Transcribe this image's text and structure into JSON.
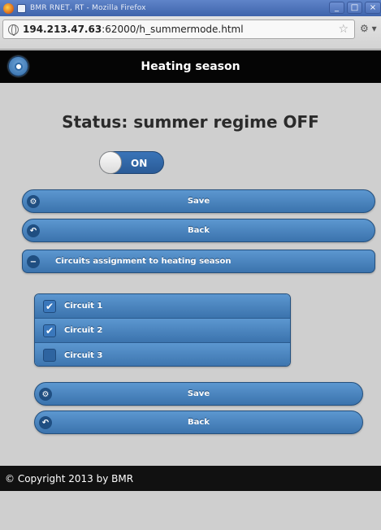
{
  "window": {
    "title": "BMR RNET, RT - Mozilla Firefox",
    "minimize": "_",
    "maximize": "□",
    "close": "×"
  },
  "browser": {
    "url_host": "194.213.47.63",
    "url_rest": ":62000/h_summermode.html",
    "bookmark_star": "☆",
    "tools_glyph": "⚙ ▾"
  },
  "header": {
    "title": "Heating season"
  },
  "status": {
    "text": "Status: summer regime OFF"
  },
  "flip_switch": {
    "label": "ON"
  },
  "top_buttons": {
    "save": "Save",
    "back": "Back"
  },
  "collapsible": {
    "title": "Circuits assignment to heating season",
    "icon_glyph": "−"
  },
  "circuits": [
    {
      "label": "Circuit 1",
      "checked": true,
      "mark": "✔"
    },
    {
      "label": "Circuit 2",
      "checked": true,
      "mark": "✔"
    },
    {
      "label": "Circuit 3",
      "checked": false,
      "mark": ""
    }
  ],
  "bottom_buttons": {
    "save": "Save",
    "back": "Back"
  },
  "footer": {
    "text": "© Copyright 2013 by BMR"
  },
  "icons": {
    "gear": "⚙",
    "back_arrow": "↶"
  },
  "colors": {
    "button_blue": "#3b73ad",
    "header_black": "#050505",
    "page_bg": "#cfcfcf"
  }
}
